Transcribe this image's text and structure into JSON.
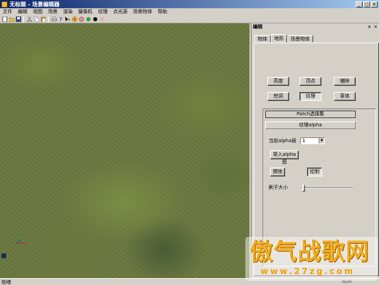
{
  "window": {
    "title": "无标题 - 场景编辑器",
    "min": "_",
    "max": "□",
    "close": "×"
  },
  "menu": [
    "文件",
    "编辑",
    "视图",
    "场景",
    "渲染",
    "摄像机",
    "纹理",
    "点光源",
    "场景物体",
    "帮助"
  ],
  "panel": {
    "title": "编辑",
    "pin": "ⅹ",
    "close": "×",
    "tabs": [
      "物体",
      "地形",
      "场景物体"
    ],
    "buttons_row1": [
      "高度",
      "顶点",
      "辅除"
    ],
    "buttons_row2": [
      "挖洞",
      "纹理",
      "草体"
    ],
    "patch_header": "Patch选择集",
    "alpha_header": "纹理alpha",
    "current_alpha_label": "当前alpha层",
    "current_alpha_value": "1",
    "import_alpha": "导入alpha图",
    "erase": "擦除",
    "draw": "绘制",
    "brush_size_label": "刷子大小",
    "brush_size_value": 0.05
  },
  "status": {
    "left": "就绪",
    "right": "NUM"
  },
  "watermark": {
    "main": "傲气战歌网",
    "sub": "www.27zg.com"
  },
  "colors": {
    "titlebar": "#0a246a",
    "face": "#d4d0c8",
    "terrain": "#6b7840",
    "watermark": "#f0b020"
  }
}
